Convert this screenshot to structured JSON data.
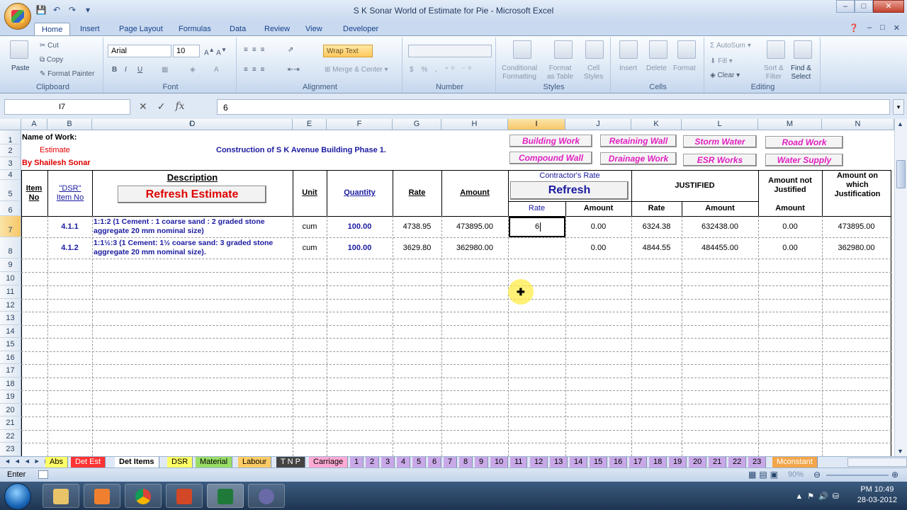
{
  "window": {
    "title": "S K Sonar World of Estimate for Pie - Microsoft Excel"
  },
  "ribbon_tabs": [
    "Home",
    "Insert",
    "Page Layout",
    "Formulas",
    "Data",
    "Review",
    "View",
    "Developer"
  ],
  "ribbon": {
    "clipboard": {
      "paste": "Paste",
      "cut": "Cut",
      "copy": "Copy",
      "format_painter": "Format Painter",
      "label": "Clipboard"
    },
    "font": {
      "name": "Arial",
      "size": "10",
      "label": "Font"
    },
    "alignment": {
      "wrap_text": "Wrap Text",
      "merge_center": "Merge & Center",
      "label": "Alignment"
    },
    "number": {
      "label": "Number"
    },
    "styles": {
      "conditional": "Conditional",
      "formatting": "Formatting",
      "format": "Format",
      "as_table": "as Table",
      "cell": "Cell",
      "styles_btn": "Styles",
      "label": "Styles"
    },
    "cells": {
      "insert": "Insert",
      "delete": "Delete",
      "format": "Format",
      "label": "Cells"
    },
    "editing": {
      "autosum": "AutoSum",
      "fill": "Fill",
      "clear": "Clear",
      "sort": "Sort &",
      "filter": "Filter",
      "find": "Find &",
      "select": "Select",
      "label": "Editing"
    }
  },
  "formula_bar": {
    "name_box": "I7",
    "fx": "fx",
    "value": "6"
  },
  "columns": [
    "A",
    "B",
    "C",
    "D",
    "E",
    "F",
    "G",
    "H",
    "I",
    "J",
    "K",
    "L",
    "M",
    "N"
  ],
  "rows": [
    "1",
    "2",
    "3",
    "4",
    "5",
    "6",
    "7",
    "8",
    "9",
    "10",
    "11",
    "12",
    "13",
    "14",
    "15",
    "16",
    "17",
    "18",
    "19",
    "20",
    "21",
    "22",
    "23"
  ],
  "sheet": {
    "name_of_work": "Name of Work:",
    "estimate": "Estimate",
    "by": "By Shailesh Sonar",
    "project": "Construction of S K Avenue Building Phase 1.",
    "buttons": [
      "Building Work",
      "Retaining Wall",
      "Storm Water",
      "Road Work",
      "Compound Wall",
      "Drainage Work",
      "ESR Works",
      "Water Supply"
    ],
    "headers": {
      "item_no": "Item No",
      "dsr": "\"DSR\" Item No",
      "description": "Description",
      "refresh_estimate": "Refresh Estimate",
      "unit": "Unit",
      "quantity": "Quantity",
      "rate": "Rate",
      "amount": "Amount",
      "contractors_rate": "Contractor's Rate",
      "refresh": "Refresh",
      "c_rate": "Rate",
      "c_amount": "Amount",
      "justified": "JUSTIFIED",
      "j_rate": "Rate",
      "j_amount": "Amount",
      "amount_not_justified": "Amount not Justified",
      "anj_amount": "Amount",
      "amount_on_which": "Amount on which Justification"
    },
    "data_rows": [
      {
        "dsr": "4.1.1",
        "desc1": "1:1:2 (1 Cement : 1 coarse sand : 2 graded stone",
        "desc2": "aggregate 20 mm nominal size)",
        "unit": "cum",
        "qty": "100.00",
        "rate": "4738.95",
        "amount": "473895.00",
        "c_rate": "6",
        "c_amount": "0.00",
        "j_rate": "6324.38",
        "j_amount": "632438.00",
        "not_justified": "0.00",
        "on_which": "473895.00"
      },
      {
        "dsr": "4.1.2",
        "desc1": "1:1½:3 (1 Cement: 1½ coarse sand: 3 graded stone",
        "desc2": "aggregate 20 mm nominal size).",
        "unit": "cum",
        "qty": "100.00",
        "rate": "3629.80",
        "amount": "362980.00",
        "c_rate": "",
        "c_amount": "0.00",
        "j_rate": "4844.55",
        "j_amount": "484455.00",
        "not_justified": "0.00",
        "on_which": "362980.00"
      }
    ]
  },
  "sheet_tabs": [
    "Abs",
    "Det Est",
    "Det Items",
    "DSR",
    "Material",
    "Labour",
    "T N P",
    "Carriage",
    "1",
    "2",
    "3",
    "4",
    "5",
    "6",
    "7",
    "8",
    "9",
    "10",
    "11",
    "12",
    "13",
    "14",
    "15",
    "16",
    "17",
    "18",
    "19",
    "20",
    "21",
    "22",
    "23",
    "Mconstant"
  ],
  "status": {
    "mode": "Enter",
    "zoom": "90%"
  },
  "taskbar": {
    "time": "PM 10:49",
    "date": "28-03-2012"
  },
  "colors": {
    "accent_pink": "#e020c0",
    "red_text": "#e00000",
    "blue_text": "#1a1aa0",
    "selected_header": "#f6c667"
  }
}
